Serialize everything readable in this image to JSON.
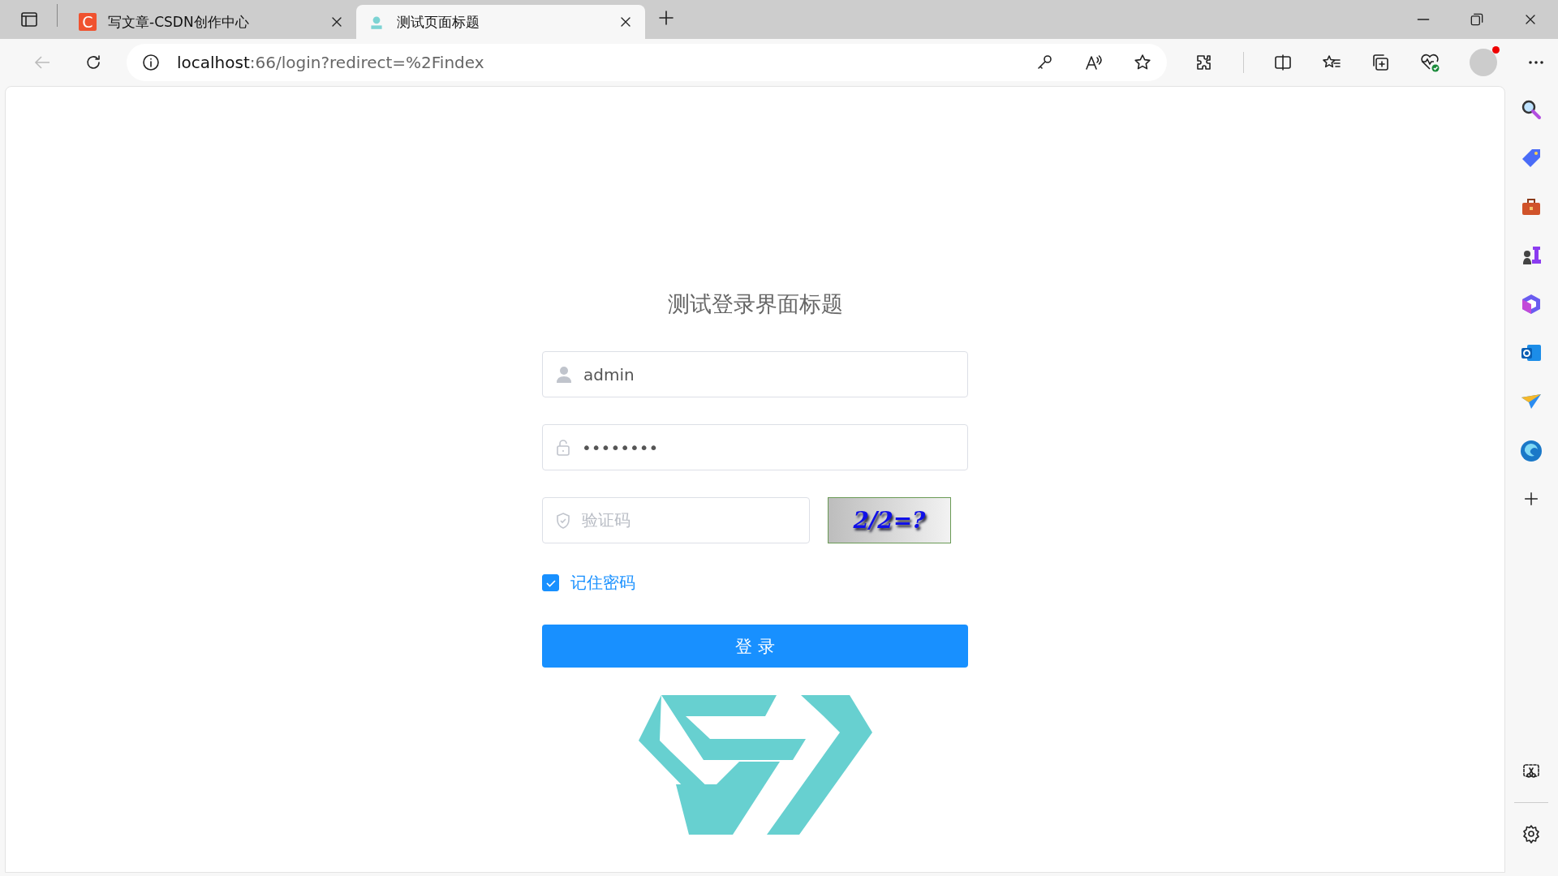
{
  "browser": {
    "tabs": [
      {
        "title": "写文章-CSDN创作中心",
        "favicon_letter": "C",
        "selected": false
      },
      {
        "title": "测试页面标题",
        "selected": true
      }
    ],
    "address": {
      "host": "localhost",
      "path": ":66/login?redirect=%2Findex"
    }
  },
  "login": {
    "title": "测试登录界面标题",
    "username": {
      "value": "admin"
    },
    "password": {
      "value": "••••••••"
    },
    "captcha": {
      "placeholder": "验证码",
      "code": "2/2=?"
    },
    "remember": {
      "label": "记住密码",
      "checked": true
    },
    "submit": "登 录"
  }
}
